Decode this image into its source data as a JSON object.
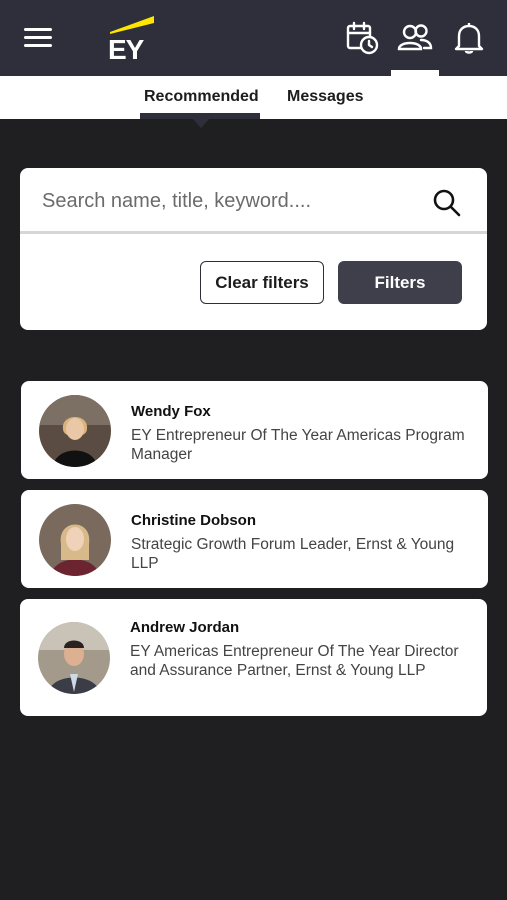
{
  "header": {
    "logo_text": "EY",
    "icons": [
      "menu-icon",
      "calendar-clock-icon",
      "people-icon",
      "bell-icon"
    ],
    "accent_color": "#ffe600",
    "bar_color": "#2f2f3b"
  },
  "tabs": [
    {
      "label": "Recommended",
      "active": true
    },
    {
      "label": "Messages",
      "active": false
    }
  ],
  "search": {
    "placeholder": "Search name, title, keyword....",
    "value": ""
  },
  "buttons": {
    "clear_filters": "Clear filters",
    "filters": "Filters"
  },
  "people": [
    {
      "name": "Wendy Fox",
      "title": "EY Entrepreneur Of The Year Americas Program Manager"
    },
    {
      "name": "Christine Dobson",
      "title": "Strategic Growth Forum Leader, Ernst & Young LLP"
    },
    {
      "name": "Andrew Jordan",
      "title": "EY Americas Entrepreneur Of The Year Director and Assurance Partner, Ernst & Young LLP"
    }
  ]
}
